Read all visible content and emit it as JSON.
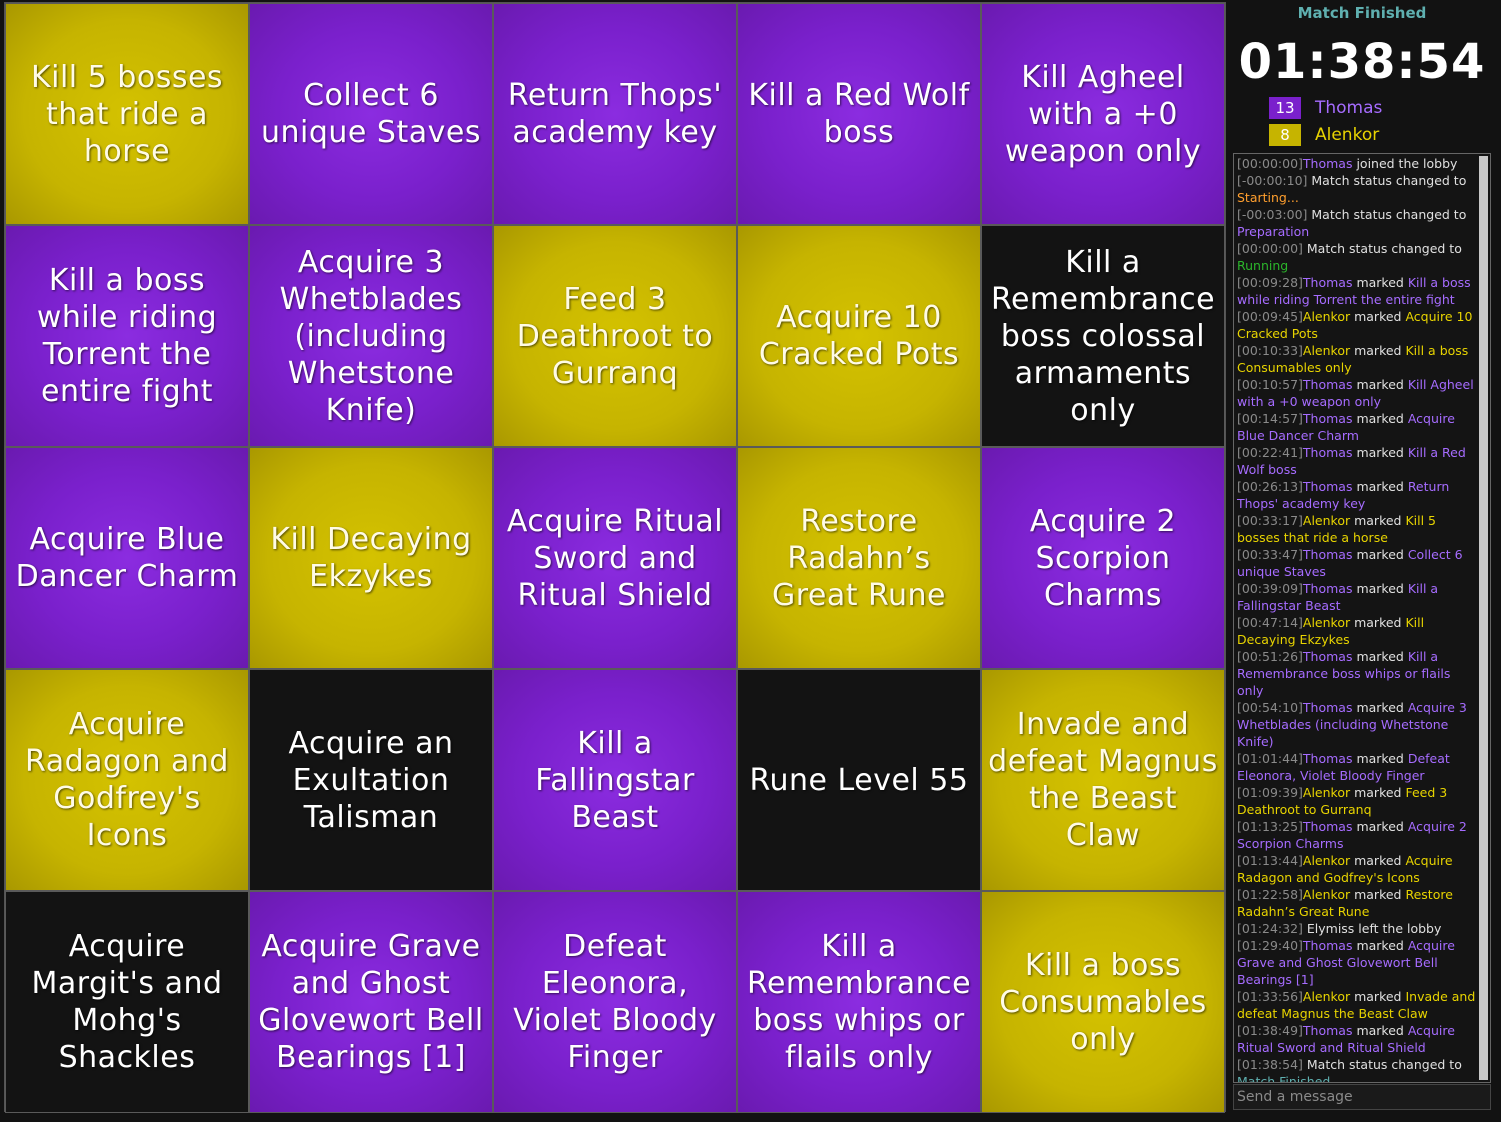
{
  "board": {
    "cells": [
      {
        "text": "Kill 5 bosses that ride a horse",
        "state": "yellow"
      },
      {
        "text": "Collect 6 unique Staves",
        "state": "purple"
      },
      {
        "text": "Return Thops' academy key",
        "state": "purple"
      },
      {
        "text": "Kill a Red Wolf boss",
        "state": "purple"
      },
      {
        "text": "Kill Agheel with a +0 weapon only",
        "state": "purple"
      },
      {
        "text": "Kill a boss while riding Torrent the entire fight",
        "state": "purple"
      },
      {
        "text": "Acquire 3 Whetblades (including Whetstone Knife)",
        "state": "purple"
      },
      {
        "text": "Feed 3 Deathroot to Gurranq",
        "state": "yellow"
      },
      {
        "text": "Acquire 10 Cracked Pots",
        "state": "yellow"
      },
      {
        "text": "Kill a Remembrance boss colossal armaments only",
        "state": "empty"
      },
      {
        "text": "Acquire Blue Dancer Charm",
        "state": "purple"
      },
      {
        "text": "Kill Decaying Ekzykes",
        "state": "yellow"
      },
      {
        "text": "Acquire Ritual Sword and Ritual Shield",
        "state": "purple"
      },
      {
        "text": "Restore Radahn’s Great Rune",
        "state": "yellow"
      },
      {
        "text": "Acquire 2 Scorpion Charms",
        "state": "purple"
      },
      {
        "text": "Acquire Radagon and Godfrey's Icons",
        "state": "yellow"
      },
      {
        "text": "Acquire an Exultation Talisman",
        "state": "empty"
      },
      {
        "text": "Kill a Fallingstar Beast",
        "state": "purple"
      },
      {
        "text": "Rune Level 55",
        "state": "empty"
      },
      {
        "text": "Invade and defeat Magnus the Beast Claw",
        "state": "yellow"
      },
      {
        "text": "Acquire Margit's and Mohg's Shackles",
        "state": "empty"
      },
      {
        "text": "Acquire Grave and Ghost Glovewort Bell Bearings [1]",
        "state": "purple"
      },
      {
        "text": "Defeat Eleonora, Violet Bloody Finger",
        "state": "purple"
      },
      {
        "text": "Kill a Remembrance boss whips or flails only",
        "state": "purple"
      },
      {
        "text": "Kill a boss Consumables only",
        "state": "yellow"
      }
    ]
  },
  "side": {
    "status": "Match Finished",
    "timer": "01:38:54",
    "players": [
      {
        "score": "13",
        "name": "Thomas",
        "color": "#7a20cc",
        "text_color": "#a66cff"
      },
      {
        "score": "8",
        "name": "Alenkor",
        "color": "#c6b400",
        "text_color": "#e8d400"
      }
    ],
    "message_placeholder": "Send a message"
  },
  "log": [
    {
      "ts": "[00:00:00]",
      "parts": [
        {
          "t": "Thomas",
          "c": "p"
        },
        {
          "t": " joined the lobby",
          "c": ""
        }
      ]
    },
    {
      "ts": "[-00:00:10]",
      "parts": [
        {
          "t": " Match status changed to ",
          "c": ""
        },
        {
          "t": "Starting...",
          "c": "st-start"
        }
      ]
    },
    {
      "ts": "[-00:03:00]",
      "parts": [
        {
          "t": " Match status changed to ",
          "c": ""
        },
        {
          "t": "Preparation",
          "c": "st-prep"
        }
      ]
    },
    {
      "ts": "[00:00:00]",
      "parts": [
        {
          "t": " Match status changed to ",
          "c": ""
        },
        {
          "t": "Running",
          "c": "st-run"
        }
      ]
    },
    {
      "ts": "[00:09:28]",
      "parts": [
        {
          "t": "Thomas",
          "c": "p"
        },
        {
          "t": " marked ",
          "c": ""
        },
        {
          "t": "Kill a boss while riding Torrent the entire fight",
          "c": "p"
        }
      ]
    },
    {
      "ts": "[00:09:45]",
      "parts": [
        {
          "t": "Alenkor",
          "c": "y"
        },
        {
          "t": " marked ",
          "c": ""
        },
        {
          "t": "Acquire 10 Cracked Pots",
          "c": "y"
        }
      ]
    },
    {
      "ts": "[00:10:33]",
      "parts": [
        {
          "t": "Alenkor",
          "c": "y"
        },
        {
          "t": " marked ",
          "c": ""
        },
        {
          "t": "Kill a boss Consumables only",
          "c": "y"
        }
      ]
    },
    {
      "ts": "[00:10:57]",
      "parts": [
        {
          "t": "Thomas",
          "c": "p"
        },
        {
          "t": " marked ",
          "c": ""
        },
        {
          "t": "Kill Agheel with a +0 weapon only",
          "c": "p"
        }
      ]
    },
    {
      "ts": "[00:14:57]",
      "parts": [
        {
          "t": "Thomas",
          "c": "p"
        },
        {
          "t": " marked ",
          "c": ""
        },
        {
          "t": "Acquire Blue Dancer Charm",
          "c": "p"
        }
      ]
    },
    {
      "ts": "[00:22:41]",
      "parts": [
        {
          "t": "Thomas",
          "c": "p"
        },
        {
          "t": " marked ",
          "c": ""
        },
        {
          "t": "Kill a Red Wolf boss",
          "c": "p"
        }
      ]
    },
    {
      "ts": "[00:26:13]",
      "parts": [
        {
          "t": "Thomas",
          "c": "p"
        },
        {
          "t": " marked ",
          "c": ""
        },
        {
          "t": "Return Thops' academy key",
          "c": "p"
        }
      ]
    },
    {
      "ts": "[00:33:17]",
      "parts": [
        {
          "t": "Alenkor",
          "c": "y"
        },
        {
          "t": " marked ",
          "c": ""
        },
        {
          "t": "Kill 5 bosses that ride a horse",
          "c": "y"
        }
      ]
    },
    {
      "ts": "[00:33:47]",
      "parts": [
        {
          "t": "Thomas",
          "c": "p"
        },
        {
          "t": " marked ",
          "c": ""
        },
        {
          "t": "Collect 6 unique Staves",
          "c": "p"
        }
      ]
    },
    {
      "ts": "[00:39:09]",
      "parts": [
        {
          "t": "Thomas",
          "c": "p"
        },
        {
          "t": " marked ",
          "c": ""
        },
        {
          "t": "Kill a Fallingstar Beast",
          "c": "p"
        }
      ]
    },
    {
      "ts": "[00:47:14]",
      "parts": [
        {
          "t": "Alenkor",
          "c": "y"
        },
        {
          "t": " marked ",
          "c": ""
        },
        {
          "t": "Kill Decaying Ekzykes",
          "c": "y"
        }
      ]
    },
    {
      "ts": "[00:51:26]",
      "parts": [
        {
          "t": "Thomas",
          "c": "p"
        },
        {
          "t": " marked ",
          "c": ""
        },
        {
          "t": "Kill a Remembrance boss whips or flails only",
          "c": "p"
        }
      ]
    },
    {
      "ts": "[00:54:10]",
      "parts": [
        {
          "t": "Thomas",
          "c": "p"
        },
        {
          "t": " marked ",
          "c": ""
        },
        {
          "t": "Acquire 3 Whetblades (including Whetstone Knife)",
          "c": "p"
        }
      ]
    },
    {
      "ts": "[01:01:44]",
      "parts": [
        {
          "t": "Thomas",
          "c": "p"
        },
        {
          "t": " marked ",
          "c": ""
        },
        {
          "t": "Defeat Eleonora, Violet Bloody Finger",
          "c": "p"
        }
      ]
    },
    {
      "ts": "[01:09:39]",
      "parts": [
        {
          "t": "Alenkor",
          "c": "y"
        },
        {
          "t": " marked ",
          "c": ""
        },
        {
          "t": "Feed 3 Deathroot to Gurranq",
          "c": "y"
        }
      ]
    },
    {
      "ts": "[01:13:25]",
      "parts": [
        {
          "t": "Thomas",
          "c": "p"
        },
        {
          "t": " marked ",
          "c": ""
        },
        {
          "t": "Acquire 2 Scorpion Charms",
          "c": "p"
        }
      ]
    },
    {
      "ts": "[01:13:44]",
      "parts": [
        {
          "t": "Alenkor",
          "c": "y"
        },
        {
          "t": " marked ",
          "c": ""
        },
        {
          "t": "Acquire Radagon and Godfrey's Icons",
          "c": "y"
        }
      ]
    },
    {
      "ts": "[01:22:58]",
      "parts": [
        {
          "t": "Alenkor",
          "c": "y"
        },
        {
          "t": " marked ",
          "c": ""
        },
        {
          "t": "Restore Radahn’s Great Rune",
          "c": "y"
        }
      ]
    },
    {
      "ts": "[01:24:32]",
      "parts": [
        {
          "t": " Elymiss left the lobby",
          "c": ""
        }
      ]
    },
    {
      "ts": "[01:29:40]",
      "parts": [
        {
          "t": "Thomas",
          "c": "p"
        },
        {
          "t": " marked ",
          "c": ""
        },
        {
          "t": "Acquire Grave and Ghost Glovewort Bell Bearings [1]",
          "c": "p"
        }
      ]
    },
    {
      "ts": "[01:33:56]",
      "parts": [
        {
          "t": "Alenkor",
          "c": "y"
        },
        {
          "t": " marked ",
          "c": ""
        },
        {
          "t": "Invade and defeat Magnus the Beast Claw",
          "c": "y"
        }
      ]
    },
    {
      "ts": "[01:38:49]",
      "parts": [
        {
          "t": "Thomas",
          "c": "p"
        },
        {
          "t": " marked ",
          "c": ""
        },
        {
          "t": "Acquire Ritual Sword and Ritual Shield",
          "c": "p"
        }
      ]
    },
    {
      "ts": "[01:38:54]",
      "parts": [
        {
          "t": " Match status changed to ",
          "c": ""
        },
        {
          "t": "Match Finished",
          "c": "st-fin"
        }
      ]
    }
  ]
}
